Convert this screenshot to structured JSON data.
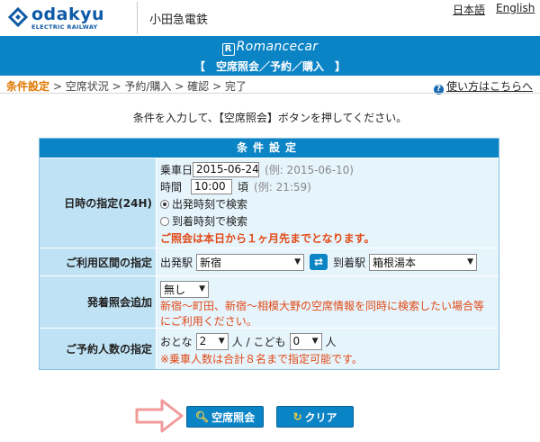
{
  "header": {
    "logo_text": "odakyu",
    "logo_sub": "ELECTRIC RAILWAY",
    "company": "小田急電鉄",
    "lang_ja": "日本語",
    "lang_en": "English"
  },
  "banner": {
    "brand": "Romancecar",
    "subtitle": "【　空席照会／予約／購入　】"
  },
  "breadcrumb": {
    "steps": [
      "条件設定",
      "空席状況",
      "予約/購入",
      "確認",
      "完了"
    ],
    "separator": " > ",
    "help": "使い方はこちらへ"
  },
  "instruction": "条件を入力して、【空席照会】ボタンを押してください。",
  "form": {
    "caption": "条件設定",
    "datetime": {
      "label": "日時の指定(24H)",
      "date_label": "乗車日",
      "date_value": "2015-06-24",
      "date_example": "(例: 2015-06-10)",
      "time_label": "時間",
      "time_value": "10:00",
      "time_suffix": "頃",
      "time_example": "(例: 21:59)",
      "radio_depart": "出発時刻で検索",
      "radio_arrive": "到着時刻で検索",
      "warning": "ご照会は本日から１ヶ月先までとなります。"
    },
    "section": {
      "label": "ご利用区間の指定",
      "from_label": "出発駅",
      "from_value": "新宿",
      "to_label": "到着駅",
      "to_value": "箱根湯本"
    },
    "extra": {
      "label": "発着照会追加",
      "value": "無し",
      "note": "新宿～町田、新宿～相模大野の空席情報を同時に検索したい場合等にご利用ください。"
    },
    "people": {
      "label": "ご予約人数の指定",
      "adult_label": "おとな",
      "adult_value": "2",
      "adult_unit": "人 /",
      "child_label": "こども",
      "child_value": "0",
      "child_unit": "人",
      "note": "※乗車人数は合計８名まで指定可能です。"
    }
  },
  "buttons": {
    "search": "空席照会",
    "clear": "クリア"
  },
  "colors": {
    "brand_blue": "#0b84c6",
    "warning": "#e24a17",
    "active_step": "#e07800"
  }
}
